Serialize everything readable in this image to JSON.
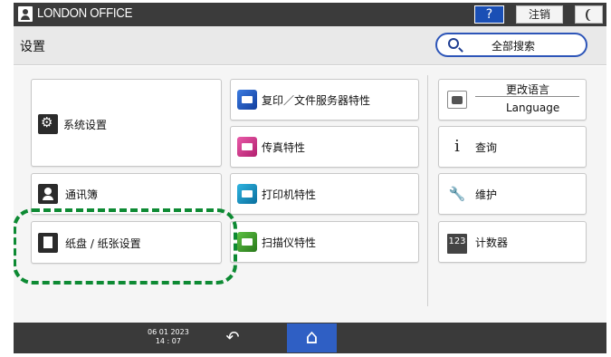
{
  "topbar": {
    "office_name": "LONDON OFFICE",
    "help_label": "?",
    "logout_label": "注销"
  },
  "titlebar": {
    "title": "设置",
    "search_label": "全部搜索"
  },
  "tiles": {
    "system_settings": "系统设置",
    "address_book": "通讯簿",
    "tray_paper": "纸盘 / 纸张设置",
    "copy_docserver": "复印／文件服务器特性",
    "fax": "传真特性",
    "printer": "打印机特性",
    "scanner": "扫描仪特性",
    "change_language_top": "更改语言",
    "change_language_bottom": "Language",
    "inquiry": "查询",
    "maintenance": "维护",
    "counter": "计数器",
    "counter_icon_text": "123"
  },
  "bottombar": {
    "date": "06 01 2023",
    "time": "14 : 07"
  },
  "colors": {
    "accent_blue": "#2f5fc4",
    "highlight_green": "#0d8a33",
    "topbar_bg": "#3b3b3b"
  },
  "icons": [
    "user-icon",
    "help-icon",
    "moon-icon",
    "search-icon",
    "gear-icon",
    "address-book-icon",
    "tray-icon",
    "copy-icon",
    "fax-icon",
    "printer-icon",
    "scanner-icon",
    "language-icon",
    "info-icon",
    "wrench-icon",
    "counter-icon",
    "back-icon",
    "home-icon"
  ]
}
